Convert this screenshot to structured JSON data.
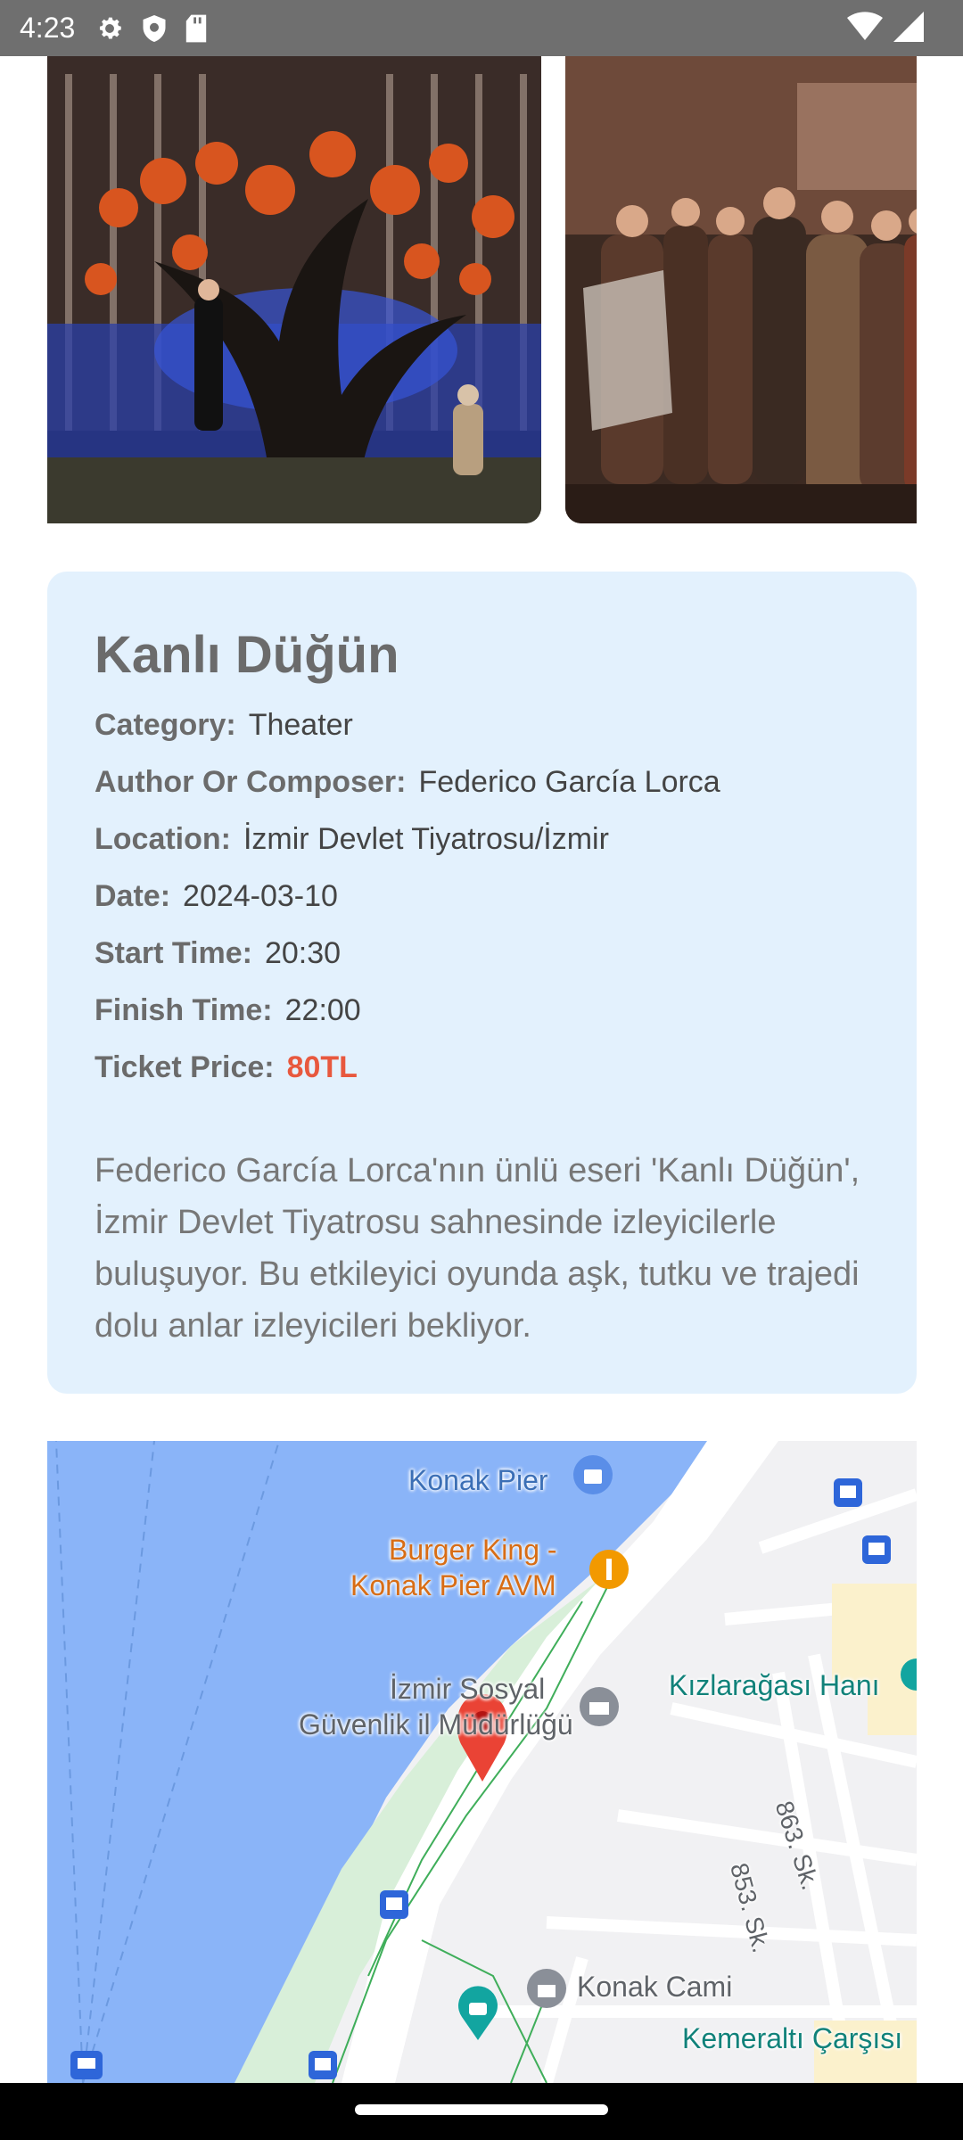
{
  "status_bar": {
    "time": "4:23",
    "icons": [
      "settings-icon",
      "shield-icon",
      "sd-card-icon",
      "wifi-icon",
      "signal-icon"
    ]
  },
  "carousel": {
    "images": [
      {
        "description_icon": "stage-photo"
      },
      {
        "description_icon": "cast-photo"
      }
    ]
  },
  "event": {
    "title": "Kanlı Düğün",
    "details": {
      "category": {
        "label": "Category:",
        "value": "Theater"
      },
      "author": {
        "label": "Author Or Composer:",
        "value": "Federico García Lorca"
      },
      "location": {
        "label": "Location:",
        "value": "İzmir Devlet Tiyatrosu/İzmir"
      },
      "date": {
        "label": "Date:",
        "value": "2024-03-10"
      },
      "start_time": {
        "label": "Start Time:",
        "value": "20:30"
      },
      "finish_time": {
        "label": "Finish Time:",
        "value": "22:00"
      },
      "ticket_price": {
        "label": "Ticket Price:",
        "value": "80TL"
      }
    },
    "description": "Federico García Lorca'nın ünlü eseri 'Kanlı Düğün', İzmir Devlet Tiyatrosu sahnesinde izleyicilerle buluşuyor. Bu etkileyici oyunda aşk, tutku ve trajedi dolu anlar izleyicileri bekliyor."
  },
  "map": {
    "labels": {
      "konak_pier": "Konak Pier",
      "burger_king_1": "Burger King -",
      "burger_king_2": "Konak Pier AVM",
      "izmir_sosyal_1": "İzmir Sosyal",
      "izmir_sosyal_2": "Güvenlik il Müdürlüğü",
      "kizlaragasi": "Kızlarağası Hanı",
      "street_863": "863. Sk.",
      "street_853": "853. Sk.",
      "konak_cami": "Konak Cami",
      "kemeralti": "Kemeraltı Çarşısı"
    },
    "colors": {
      "water": "#8ab4f8",
      "land": "#f1f1f3",
      "park": "#d8efd9",
      "pin": "#ea4335"
    }
  },
  "colors": {
    "card_bg": "#e3f1fd",
    "price": "#e8583e",
    "label": "#6b6b6b"
  }
}
